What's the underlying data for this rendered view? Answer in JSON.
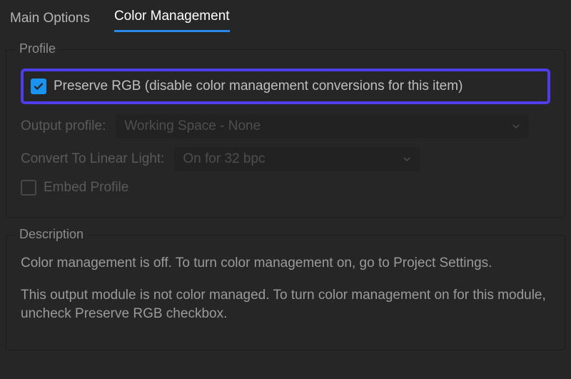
{
  "tabs": {
    "main": "Main Options",
    "color": "Color Management"
  },
  "profile": {
    "title": "Profile",
    "preserve_label": "Preserve RGB (disable color management conversions for this item)",
    "output_profile_label": "Output profile:",
    "output_profile_value": "Working Space - None",
    "convert_label": "Convert To Linear Light:",
    "convert_value": "On for 32 bpc",
    "embed_label": "Embed Profile"
  },
  "description": {
    "title": "Description",
    "line1": "Color management is off. To turn color management on, go to Project Settings.",
    "line2": "This output module is not color managed. To turn color management on for this module, uncheck Preserve RGB checkbox."
  }
}
